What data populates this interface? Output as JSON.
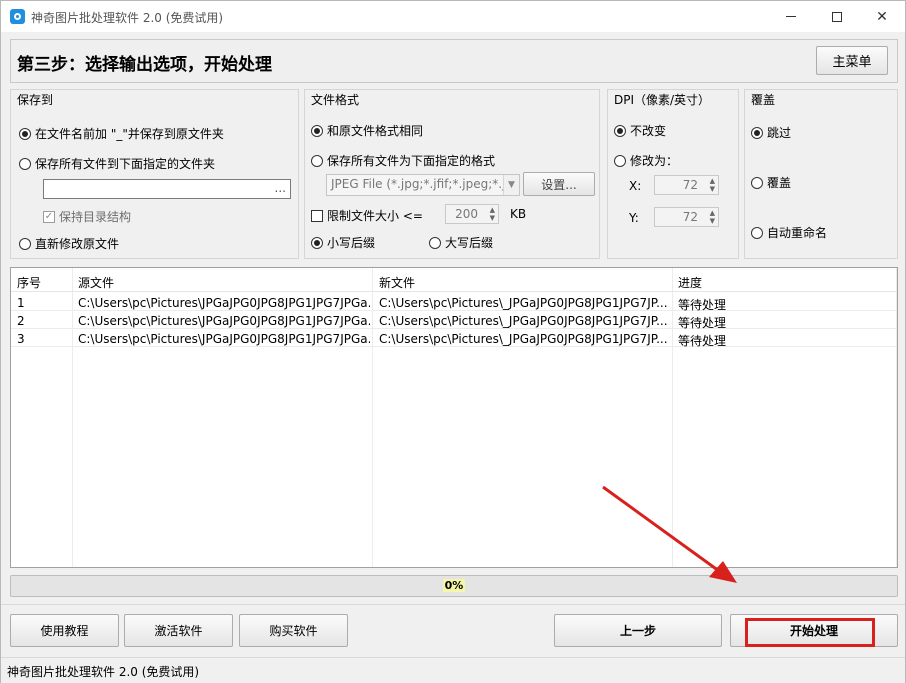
{
  "window": {
    "title": "神奇图片批处理软件 2.0 (免费试用)",
    "controls": {
      "minimize": "minimize-icon",
      "maximize": "maximize-icon",
      "close": "✕"
    }
  },
  "header": {
    "step_title": "第三步：选择输出选项，开始处理",
    "main_menu_label": "主菜单"
  },
  "save_to": {
    "title": "保存到",
    "option1": "在文件名前加 \"_\"并保存到原文件夹",
    "option2": "保存所有文件到下面指定的文件夹",
    "folder_value": "",
    "browse_label": "...",
    "keep_structure": "保持目录结构",
    "option3": "直新修改原文件"
  },
  "file_format": {
    "title": "文件格式",
    "option1": "和原文件格式相同",
    "option2": "保存所有文件为下面指定的格式",
    "format_value": "JPEG File (*.jpg;*.jfif;*.jpeg;*.j",
    "settings_label": "设置...",
    "limit_size_label": "限制文件大小 <=",
    "limit_size_value": "200",
    "limit_size_unit": "KB",
    "lowercase_ext": "小写后缀",
    "uppercase_ext": "大写后缀"
  },
  "dpi": {
    "title": "DPI（像素/英寸）",
    "option1": "不改变",
    "option2": "修改为：",
    "x_label": "X:",
    "x_value": "72",
    "y_label": "Y:",
    "y_value": "72"
  },
  "overwrite": {
    "title": "覆盖",
    "option1": "跳过",
    "option2": "覆盖",
    "option3": "自动重命名"
  },
  "table": {
    "columns": [
      "序号",
      "源文件",
      "新文件",
      "进度"
    ],
    "rows": [
      {
        "index": "1",
        "source": "C:\\Users\\pc\\Pictures\\JPGaJPG0JPG8JPG1JPG7JPGa...",
        "target": "C:\\Users\\pc\\Pictures\\_JPGaJPG0JPG8JPG1JPG7JP...",
        "status": "等待处理"
      },
      {
        "index": "2",
        "source": "C:\\Users\\pc\\Pictures\\JPGaJPG0JPG8JPG1JPG7JPGa...",
        "target": "C:\\Users\\pc\\Pictures\\_JPGaJPG0JPG8JPG1JPG7JP...",
        "status": "等待处理"
      },
      {
        "index": "3",
        "source": "C:\\Users\\pc\\Pictures\\JPGaJPG0JPG8JPG1JPG7JPGa...",
        "target": "C:\\Users\\pc\\Pictures\\_JPGaJPG0JPG8JPG1JPG7JP...",
        "status": "等待处理"
      }
    ]
  },
  "progress": {
    "label": "0%",
    "value": 0
  },
  "buttons": {
    "tutorial": "使用教程",
    "activate": "激活软件",
    "buy": "购买软件",
    "previous": "上一步",
    "start": "开始处理"
  },
  "statusbar": {
    "text": "神奇图片批处理软件 2.0 (免费试用)"
  },
  "colors": {
    "highlight": "#d8211c",
    "progress_fill": "#06b025"
  }
}
